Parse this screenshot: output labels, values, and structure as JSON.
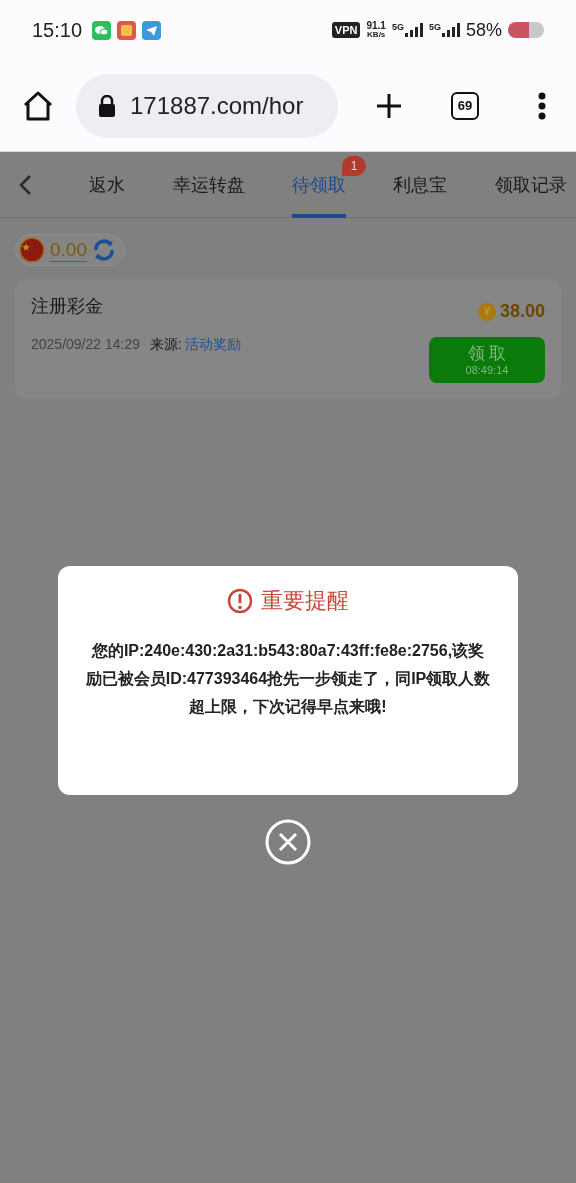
{
  "status_bar": {
    "time": "15:10",
    "vpn": "VPN",
    "speed": "91.1",
    "speed_unit": "KB/s",
    "sims": [
      "5G",
      "5G"
    ],
    "battery": "58%"
  },
  "browser": {
    "url": "171887.com/hor",
    "tab_count": "69"
  },
  "tabs": [
    {
      "label": "返水",
      "selected": false
    },
    {
      "label": "幸运转盘",
      "selected": false
    },
    {
      "label": "待领取",
      "selected": true,
      "badge": "1"
    },
    {
      "label": "利息宝",
      "selected": false
    },
    {
      "label": "领取记录",
      "selected": false
    }
  ],
  "balance": "0.00",
  "rewards": [
    {
      "title": "注册彩金",
      "currency": "¥",
      "amount": "38.00",
      "date": "2025/09/22 14:29",
      "source_label": "来源:",
      "source": "活动奖励",
      "button": "领 取",
      "countdown": "08:49:14"
    }
  ],
  "dialog": {
    "title": "重要提醒",
    "message": "您的IP:240e:430:2a31:b543:80a7:43ff:fe8e:2756,该奖励已被会员ID:477393464抢先一步领走了，同IP领取人数超上限，下次记得早点来哦!"
  }
}
